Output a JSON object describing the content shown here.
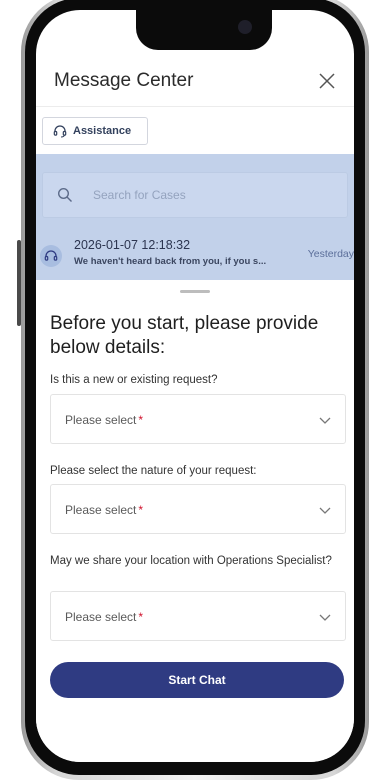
{
  "header": {
    "title": "Message Center"
  },
  "assistance": {
    "label": "Assistance"
  },
  "search": {
    "placeholder": "Search for Cases"
  },
  "case": {
    "timestamp": "2026-01-07 12:18:32",
    "preview": "We haven't heard back from you, if you s...",
    "date_label": "Yesterday"
  },
  "form": {
    "heading": "Before you start, please provide below details:",
    "questions": [
      {
        "label": "Is this a new or existing request?",
        "placeholder": "Please select",
        "required_mark": "*"
      },
      {
        "label": "Please select the nature of your request:",
        "placeholder": "Please select",
        "required_mark": "*"
      },
      {
        "label": "May we share your location with Operations Specialist?",
        "placeholder": "Please select",
        "required_mark": "*"
      }
    ],
    "submit_label": "Start Chat"
  },
  "colors": {
    "accent": "#2f3b82",
    "dim_overlay": "#c2d1ea",
    "required": "#d0112b"
  },
  "icons": [
    "close-icon",
    "headset-icon",
    "search-icon",
    "chevron-down-icon"
  ]
}
